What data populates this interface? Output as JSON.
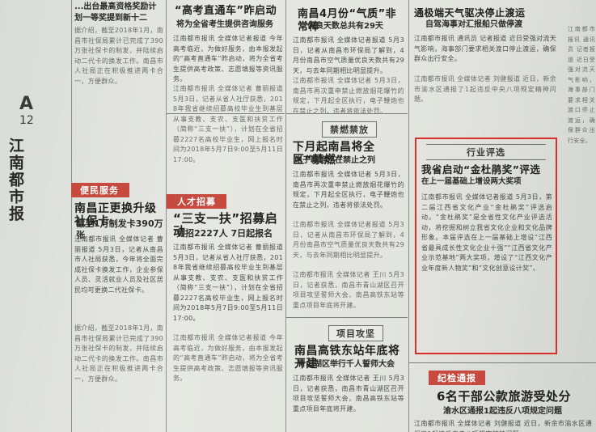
{
  "page": {
    "letter": "A",
    "number": "12",
    "masthead": "江南都市报"
  },
  "col0": {
    "top_head": "...出台最高资格奖励计划一等奖提到新十二",
    "section": "便民服务",
    "h1": "南昌正更换升级社保卡",
    "h1_sub": "截至1月制发卡390万张",
    "body1": "江南都市报讯 全媒体记者 曹丽报道 5月3日，记者从南昌市人社局获悉，今年将全面完成社保卡换发工作，企业参保人员、灵活就业人员及社区居民均可更换二代社保卡。",
    "body2": "据介绍，截至2018年1月，南昌市社保局累计已完成了390万张社保卡的制发，并陆续启动二代卡的换发工作。南昌市人社局正在积极推进两卡合一，方便群众。"
  },
  "col1": {
    "top_head": "“高考直通车”昨启动",
    "top_sub": "将为全省考生提供咨询服务",
    "top_body": "江南都市报讯 全媒体记者报道 今年高考临近，为做好服务，由本报发起的“高考直通车”昨启动，将为全省考生提供高考政策、志愿填报等资讯服务。",
    "section": "人才招募",
    "h2": "“三支一扶”招募启动",
    "h2_sub": "共招2227人 7日起报名",
    "body": "江南都市报讯 全媒体记者 曹丽报道 5月3日，记者从省人社厅获悉，2018年我省继续招募高校毕业生到基层从事支教、支农、支医和扶贫工作（简称“三支一扶”），计划在全省招募2227名高校毕业生，网上报名时间为2018年5月7日9:00至5月11日17:00。"
  },
  "col2": {
    "top_head": "南昌4月份“气质”非常棒",
    "top_sub": "优良天数总共有29天",
    "top_body": "江南都市报讯 全媒体记者报道 5月3日，记者从南昌市环保局了解到，4月份南昌市空气质量优良天数共有29天，与去年同期相比明显提升。",
    "section": "禁燃禁放",
    "h3": "下月起南昌将全区“禁燃”",
    "h3_sub": "电子鞭炮也在禁止之列",
    "body": "江南都市报讯 全媒体记者 5月3日，南昌市再次重申禁止燃放烟花爆竹的规定，下月起全区执行，电子鞭炮也在禁止之列，违者将依法处罚。",
    "section2": "项目攻坚",
    "h4": "南昌高铁东站年底将开建",
    "h4_sub": "青山湖区举行千人誓师大会",
    "body2": "江南都市报讯 全媒体记者 王川 5月3日，记者获悉，南昌市青山湖区召开项目攻坚誓师大会，南昌高铁东站等重点项目年底将开建。"
  },
  "col3": {
    "top_head": "通极端天气驱决停止渡运",
    "top_sub": "自驾海事对汇报船只做停渡",
    "top_body": "江南都市报讯 通讯员 记者报道 近日受强对流天气影响，海事部门要求相关渡口停止渡运，确保群众出行安全。",
    "section": "行业评选",
    "h5": "我省启动“金杜鹃奖”评选",
    "h5_sub": "在上一届基础上增设两大奖项",
    "body": "江南都市报讯 全媒体记者报道 5月3日，第二届江西省文化产业“金杜鹃奖”评选启动。“金杜鹃奖”是全省性文化产业评选活动，将挖掘和树立我省文化企业和文化品牌形象。本届评选在上一届基础上增设“江西省最具成长性文化企业十强”“江西省文化产业示范基地”两大奖项，增设了“江西文化产业年度新人物奖”和“文化创意设计奖”。",
    "section2": "纪检通报",
    "h6": "6名干部公款旅游受处分",
    "h6_sub": "渝水区通报1起违反八项规定问题",
    "body2": "江南都市报讯 全媒体记者 刘健报道 近日，新余市渝水区通报了1起违反中央八项规定精神问题。"
  }
}
